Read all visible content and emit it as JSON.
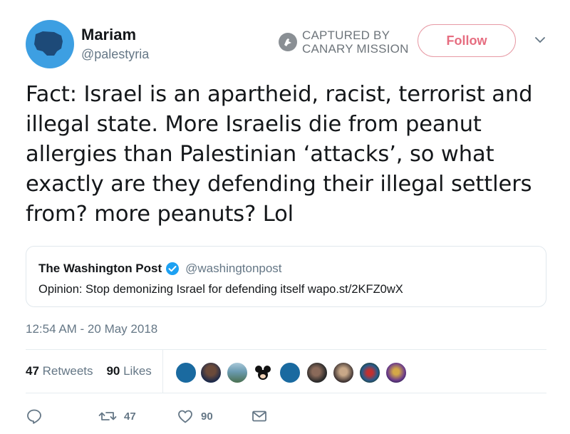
{
  "author": {
    "name": "Mariam",
    "handle": "@palestyria"
  },
  "badge": {
    "line1": "CAPTURED BY",
    "line2": "CANARY MISSION",
    "icon": "canary-bird-icon"
  },
  "follow": {
    "label": "Follow"
  },
  "tweet": {
    "lines": [
      "Fact: Israel is an apartheid, racist, terrorist and",
      "illegal state. More Israelis die from peanut",
      "allergies than Palestinian ‘attacks’, so what",
      "exactly are they defending their illegal settlers",
      "from? more peanuts? Lol"
    ]
  },
  "quote": {
    "name": "The Washington Post",
    "handle": "@washingtonpost",
    "text": "Opinion: Stop demonizing Israel for defending itself wapo.st/2KFZ0wX"
  },
  "timestamp": "12:54 AM - 20 May 2018",
  "stats": {
    "retweets": "47",
    "retweets_label": "Retweets",
    "likes": "90",
    "likes_label": "Likes"
  },
  "actions": {
    "reply_icon": "reply-icon",
    "retweet_count": "47",
    "like_count": "90",
    "dm_icon": "envelope-icon"
  },
  "colors": {
    "accent": "#1da1f2",
    "follow_pink": "#e66d80",
    "muted": "#657786"
  }
}
